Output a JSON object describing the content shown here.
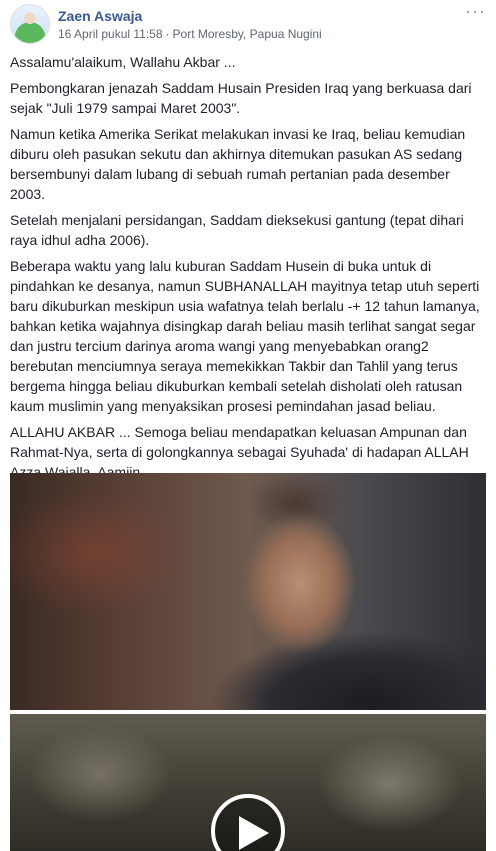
{
  "post": {
    "author": "Zaen Aswaja",
    "date": "16 April pukul 11:58",
    "separator": "·",
    "location": "Port Moresby, Papua Nugini",
    "more_label": "···",
    "paragraphs": [
      "Assalamu'alaikum, Wallahu Akbar ...",
      "Pembongkaran jenazah Saddam Husain Presiden Iraq yang berkuasa dari sejak \"Juli 1979 sampai Maret 2003\".",
      "Namun ketika Amerika Serikat melakukan invasi ke Iraq, beliau kemudian diburu oleh pasukan sekutu dan akhirnya ditemukan pasukan AS sedang bersembunyi dalam lubang di sebuah rumah pertanian pada desember 2003.",
      "Setelah menjalani persidangan, Saddam dieksekusi gantung (tepat dihari raya idhul adha 2006).",
      "Beberapa waktu yang lalu kuburan Saddam Husein di buka untuk di pindahkan ke desanya, namun SUBHANALLAH mayitnya tetap utuh seperti baru dikuburkan meskipun usia wafatnya telah berlalu -+ 12 tahun lamanya, bahkan ketika wajahnya disingkap darah beliau masih terlihat sangat segar dan justru tercium darinya aroma wangi yang menyebabkan orang2 berebutan menciumnya seraya memekikkan Takbir dan Tahlil yang terus bergema hingga beliau dikuburkan kembali setelah disholati oleh ratusan kaum muslimin yang menyaksikan prosesi pemindahan jasad beliau.",
      "ALLAHU AKBAR ... Semoga beliau mendapatkan keluasan Ampunan dan Rahmat-Nya, serta di golongkannya sebagai Syuhada' di hadapan ALLAH Azza Wajalla. Aamiin ..."
    ]
  },
  "media": {
    "photo_icon": "portrait-photo",
    "video_icon": "play-icon"
  }
}
